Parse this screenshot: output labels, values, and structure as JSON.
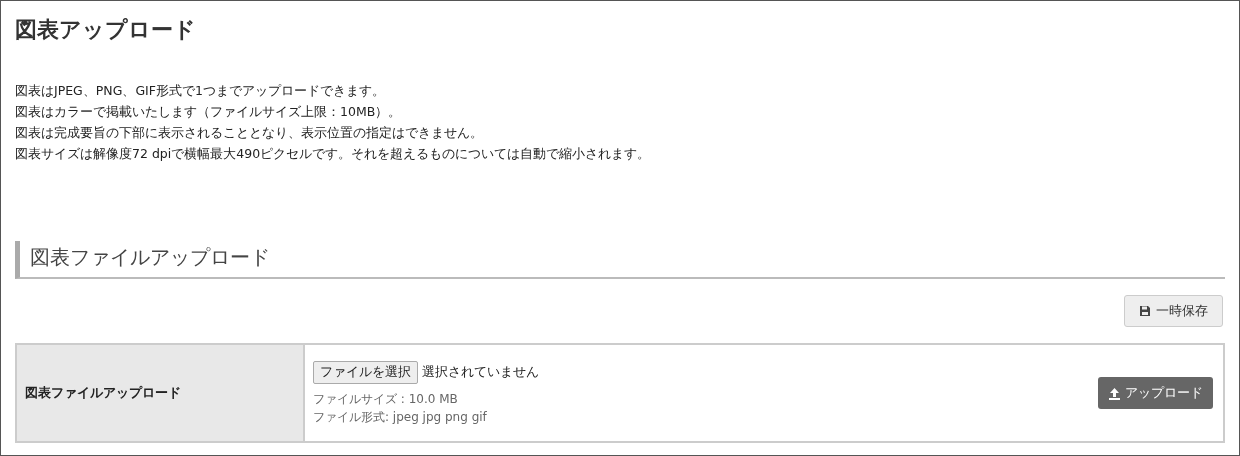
{
  "page_title": "図表アップロード",
  "notes": [
    "図表はJPEG、PNG、GIF形式で1つまでアップロードできます。",
    "図表はカラーで掲載いたします（ファイルサイズ上限：10MB）。",
    "図表は完成要旨の下部に表示されることとなり、表示位置の指定はできません。",
    "図表サイズは解像度72 dpiで横幅最大490ピクセルです。それを超えるものについては自動で縮小されます。"
  ],
  "section_heading": "図表ファイルアップロード",
  "save_button": "一時保存",
  "form_row": {
    "label": "図表ファイルアップロード",
    "choose_button": "ファイルを選択",
    "file_status": "選択されていません",
    "size_hint": "ファイルサイズ : 10.0 MB",
    "format_hint": "ファイル形式: jpeg jpg png gif",
    "upload_button": "アップロード"
  }
}
